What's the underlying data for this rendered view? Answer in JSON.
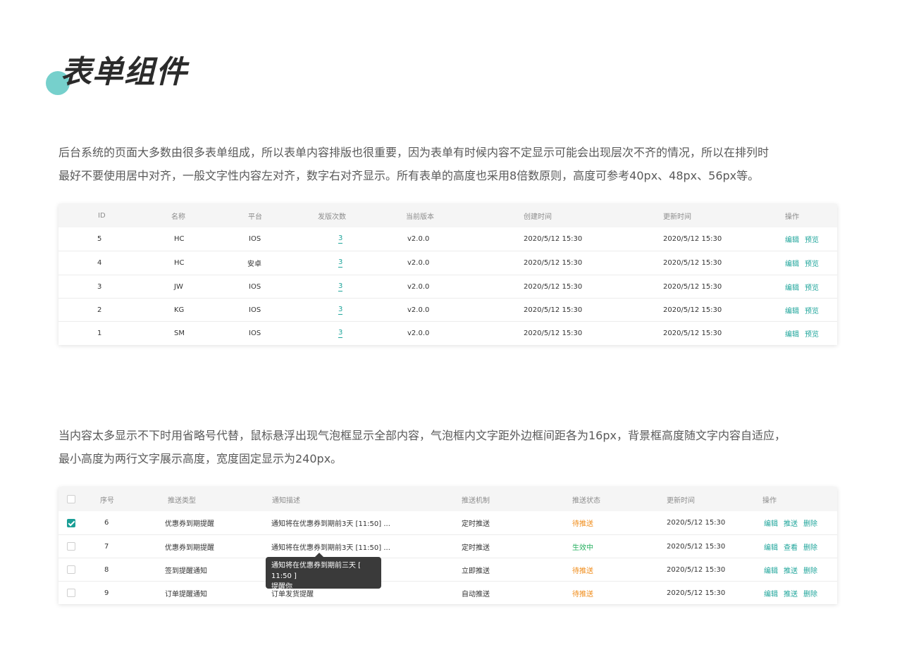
{
  "page": {
    "title": "表单组件",
    "accent": "#5ec8c3",
    "link_color": "#1fa59b"
  },
  "intro1": {
    "line1": "后台系统的页面大多数由很多表单组成，所以表单内容排版也很重要，因为表单有时候内容不定显示可能会出现层次不齐的情况，所以在排列时",
    "line2": "最好不要使用居中对齐，一般文字性内容左对齐，数字右对齐显示。所有表单的高度也采用8倍数原则，高度可参考40px、48px、56px等。"
  },
  "table1": {
    "headers": [
      "ID",
      "名称",
      "平台",
      "发版次数",
      "当前版本",
      "创建时间",
      "更新时间",
      "操作"
    ],
    "rows": [
      {
        "id": "5",
        "name": "HC",
        "platform": "IOS",
        "count": "3",
        "version": "v2.0.0",
        "created": "2020/5/12 15:30",
        "updated": "2020/5/12 15:30"
      },
      {
        "id": "4",
        "name": "HC",
        "platform": "安卓",
        "count": "3",
        "version": "v2.0.0",
        "created": "2020/5/12 15:30",
        "updated": "2020/5/12 15:30"
      },
      {
        "id": "3",
        "name": "JW",
        "platform": "IOS",
        "count": "3",
        "version": "v2.0.0",
        "created": "2020/5/12 15:30",
        "updated": "2020/5/12 15:30"
      },
      {
        "id": "2",
        "name": "KG",
        "platform": "IOS",
        "count": "3",
        "version": "v2.0.0",
        "created": "2020/5/12 15:30",
        "updated": "2020/5/12 15:30"
      },
      {
        "id": "1",
        "name": "SM",
        "platform": "IOS",
        "count": "3",
        "version": "v2.0.0",
        "created": "2020/5/12 15:30",
        "updated": "2020/5/12 15:30"
      }
    ],
    "action_edit": "编辑",
    "action_preview": "预览"
  },
  "intro2": {
    "line1": "当内容太多显示不下时用省略号代替，鼠标悬浮出现气泡框显示全部内容，气泡框内文字距外边框间距各为16px，背景框高度随文字内容自适应，",
    "line2": "最小高度为两行文字展示高度，宽度固定显示为240px。"
  },
  "table2": {
    "headers": [
      "序号",
      "推送类型",
      "通知描述",
      "推送机制",
      "推送状态",
      "更新时间",
      "操作"
    ],
    "rows": [
      {
        "checked": true,
        "no": "6",
        "type": "优惠券到期提醒",
        "desc": "通知将在优惠券到期前3天 [11:50] ...",
        "mechanism": "定时推送",
        "status": "待推送",
        "status_color": "#f08c1a",
        "updated": "2020/5/12 15:30",
        "ops": [
          "编辑",
          "推送",
          "删除"
        ]
      },
      {
        "checked": false,
        "no": "7",
        "type": "优惠券到期提醒",
        "desc": "通知将在优惠券到期前3天 [11:50] ...",
        "mechanism": "定时推送",
        "status": "生效中",
        "status_color": "#27b060",
        "updated": "2020/5/12 15:30",
        "ops": [
          "编辑",
          "查看",
          "删除"
        ]
      },
      {
        "checked": false,
        "no": "8",
        "type": "签到提醒通知",
        "desc": "",
        "mechanism": "立即推送",
        "status": "待推送",
        "status_color": "#f08c1a",
        "updated": "2020/5/12 15:30",
        "ops": [
          "编辑",
          "推送",
          "删除"
        ]
      },
      {
        "checked": false,
        "no": "9",
        "type": "订单提醒通知",
        "desc": "订单发货提醒",
        "mechanism": "自动推送",
        "status": "待推送",
        "status_color": "#f08c1a",
        "updated": "2020/5/12 15:30",
        "ops": [
          "编辑",
          "推送",
          "删除"
        ]
      }
    ],
    "tooltip": {
      "line1": "通知将在优惠券到期前三天 [ 11:50 ]",
      "line2": "提醒你"
    }
  }
}
